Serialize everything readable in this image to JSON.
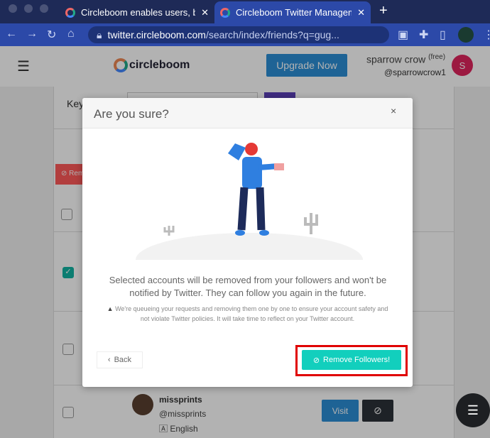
{
  "browser": {
    "tabs": [
      {
        "title": "Circleboom enables users, bran",
        "active": false
      },
      {
        "title": "Circleboom Twitter Managemen",
        "active": true
      }
    ],
    "new_tab": "+",
    "url_domain": "twitter.circleboom.com",
    "url_path": "/search/index/friends?q=gug..."
  },
  "header": {
    "logo": "circleboom",
    "upgrade": "Upgrade Now",
    "user_name": "sparrow crow",
    "plan": "(free)",
    "handle": "@sparrowcrow1",
    "avatar_letter": "S"
  },
  "page": {
    "keyword_label": "Key",
    "remove_label": "Remo",
    "rows": [
      {
        "checked": false
      },
      {
        "checked": true
      },
      {
        "checked": false
      },
      {
        "checked": false,
        "name": "missprints",
        "handle": "@missprints",
        "language": "English",
        "visit": "Visit"
      }
    ]
  },
  "modal": {
    "title": "Are you sure?",
    "close": "×",
    "message": "Selected accounts will be removed from your followers and won't be notified by Twitter. They can follow you again in the future.",
    "warning": "We're queueing your requests and removing them one by one to ensure your account safety and not violate Twitter policies. It will take time to reflect on your Twitter account.",
    "back": "Back",
    "confirm": "Remove Followers!"
  },
  "colors": {
    "accent": "#12cfbd",
    "upgrade": "#2b8fd6",
    "avatar": "#e0245e",
    "highlight": "#e00000"
  }
}
